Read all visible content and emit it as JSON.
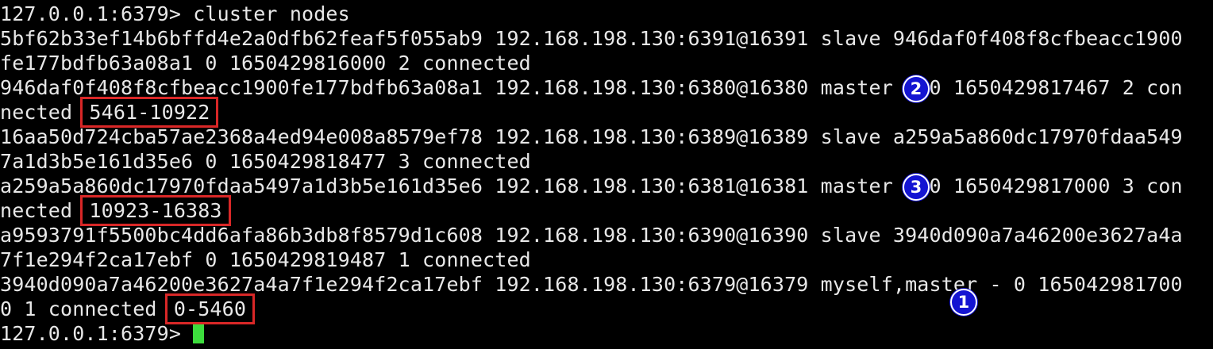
{
  "terminal": {
    "colors": {
      "background": "#000000",
      "text": "#e8e8e8",
      "highlight_box": "#d92727",
      "badge": "#1414d2",
      "cursor": "#3ddc3d"
    },
    "lines": [
      "127.0.0.1:6379> cluster nodes",
      "5bf62b33ef14b6bffd4e2a0dfb62feaf5f055ab9 192.168.198.130:6391@16391 slave 946daf0f408f8cfbeacc1900",
      "fe177bdfb63a08a1 0 1650429816000 2 connected",
      "946daf0f408f8cfbeacc1900fe177bdfb63a08a1 192.168.198.130:6380@16380 master - 0 1650429817467 2 con",
      "16aa50d724cba57ae2368a4ed94e008a8579ef78 192.168.198.130:6389@16389 slave a259a5a860dc17970fdaa549",
      "7a1d3b5e161d35e6 0 1650429818477 3 connected",
      "a259a5a860dc17970fdaa5497a1d3b5e161d35e6 192.168.198.130:6381@16381 master - 0 1650429817000 3 con",
      "a9593791f5500bc4dd6afa86b3db8f8579d1c608 192.168.198.130:6390@16390 slave 3940d090a7a46200e3627a4a",
      "7f1e294f2ca17ebf 0 1650429819487 1 connected",
      "3940d090a7a46200e3627a4a7f1e294f2ca17ebf 192.168.198.130:6379@16379 myself,master - 0 165042981700"
    ],
    "slot_lines": [
      {
        "prefix": "nected ",
        "slots": "5461-10922"
      },
      {
        "prefix": "nected ",
        "slots": "10923-16383"
      },
      {
        "prefix": "0 1 connected ",
        "slots": "0-5460"
      }
    ],
    "prompt": "127.0.0.1:6379> ",
    "badges": [
      "2",
      "3",
      "1"
    ]
  }
}
